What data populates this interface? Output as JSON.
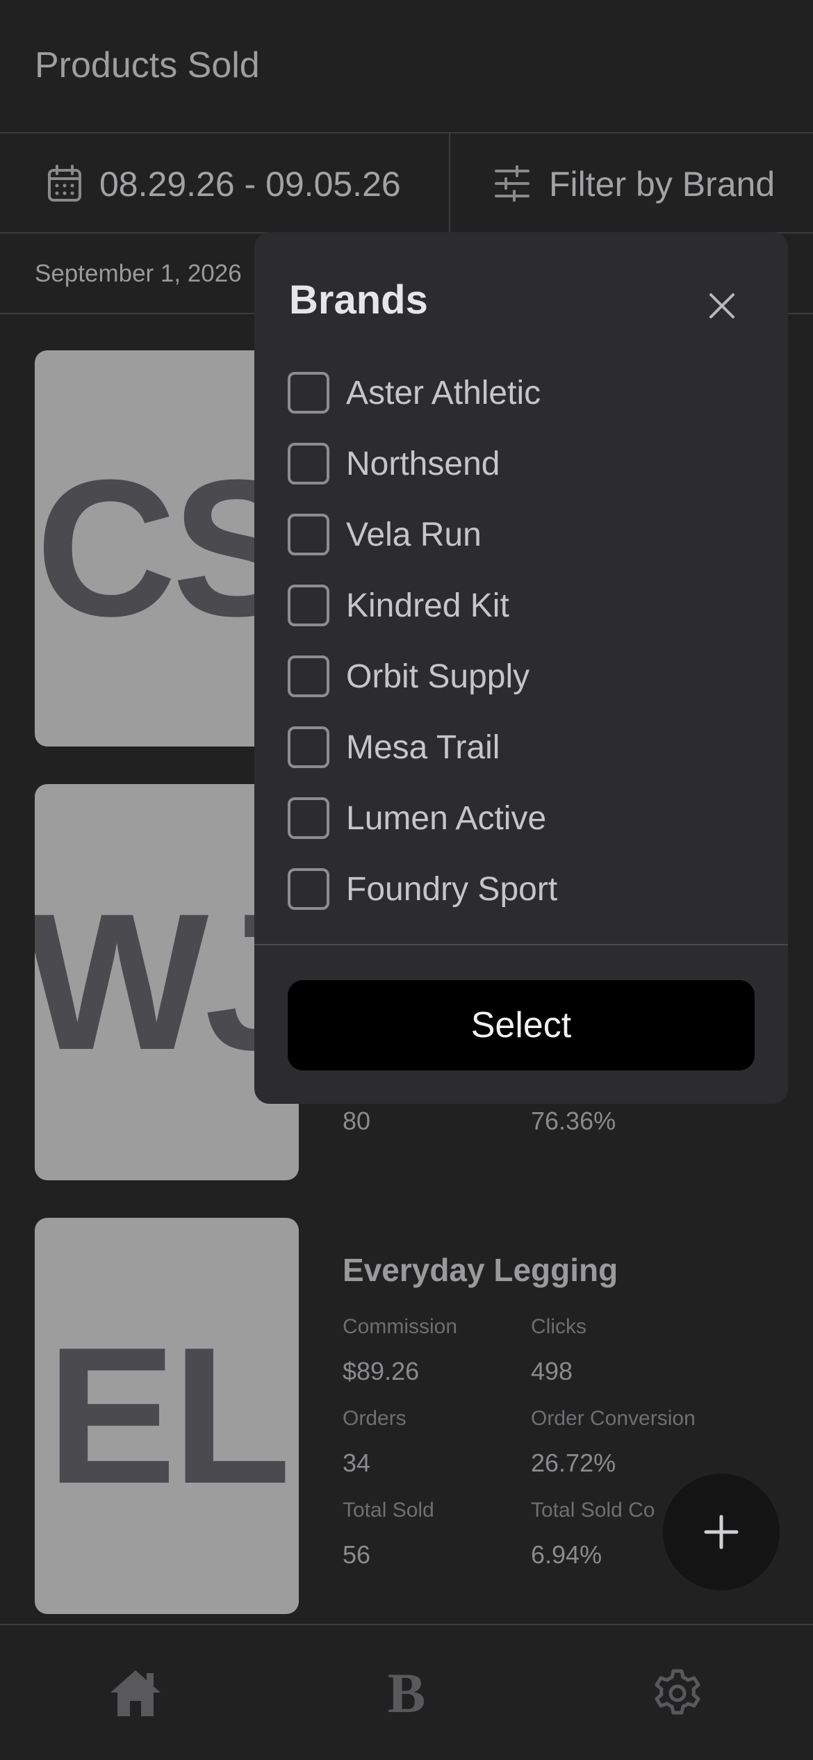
{
  "header": {
    "title": "Products Sold"
  },
  "filters": {
    "date_range": "08.29.26 - 09.05.26",
    "brand_filter_label": "Filter by Brand"
  },
  "date_heading": "September 1, 2026",
  "products": [
    {
      "initials": "CS"
    },
    {
      "initials": "WJ",
      "metrics_partial": {
        "total_sold": "80",
        "total_sold_conversion": "76.36%"
      }
    },
    {
      "initials": "EL",
      "name": "Everyday Legging",
      "labels": {
        "commission": "Commission",
        "clicks": "Clicks",
        "orders": "Orders",
        "order_conversion": "Order Conversion",
        "total_sold": "Total Sold",
        "total_sold_conversion": "Total Sold Co"
      },
      "values": {
        "commission": "$89.26",
        "clicks": "498",
        "orders": "34",
        "order_conversion": "26.72%",
        "total_sold": "56",
        "total_sold_conversion": "6.94%"
      }
    }
  ],
  "brands_modal": {
    "title": "Brands",
    "brands": [
      {
        "label": "Aster Athletic",
        "checked": false
      },
      {
        "label": "Northsend",
        "checked": false
      },
      {
        "label": "Vela Run",
        "checked": false
      },
      {
        "label": "Kindred Kit",
        "checked": false
      },
      {
        "label": "Orbit Supply",
        "checked": false
      },
      {
        "label": "Mesa Trail",
        "checked": false
      },
      {
        "label": "Lumen Active",
        "checked": false
      },
      {
        "label": "Foundry Sport",
        "checked": false
      }
    ],
    "select_label": "Select"
  },
  "bottom_nav": {
    "items": [
      {
        "icon": "home-icon"
      },
      {
        "icon": "brand-b-icon",
        "glyph": "B"
      },
      {
        "icon": "gear-icon"
      }
    ]
  },
  "fab": {
    "icon": "plus-icon"
  },
  "colors": {
    "background": "#212122",
    "modal_background": "#2c2c2e",
    "button_background": "#000000",
    "thumbnail": "#9d9d9e"
  }
}
